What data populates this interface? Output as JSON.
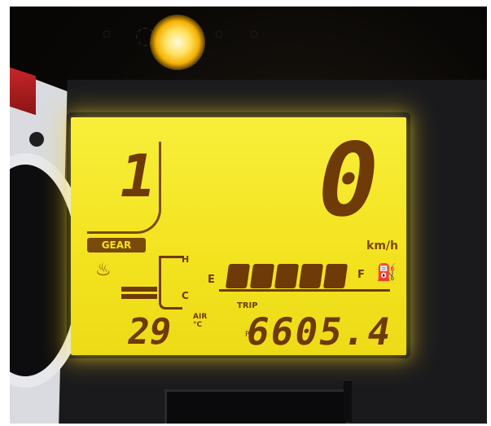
{
  "dashboard": {
    "gear": {
      "value": "1",
      "label": "GEAR"
    },
    "speed": {
      "value": "0",
      "unit": "km/h"
    },
    "coolant": {
      "high_label": "H",
      "low_label": "C",
      "level_bars": 2
    },
    "fuel": {
      "empty_label": "E",
      "full_label": "F",
      "segments_lit": 5,
      "segments_total": 5
    },
    "trip": {
      "label": "TRIP",
      "value": "6605.4",
      "sub_label": "P"
    },
    "air_temp": {
      "value": "29",
      "label_line1": "AIR",
      "label_line2": "°C"
    },
    "colors": {
      "lcd_background": "#f3e21e",
      "segment": "#6e3a07",
      "indicator_lamp": "#ffd040"
    }
  }
}
